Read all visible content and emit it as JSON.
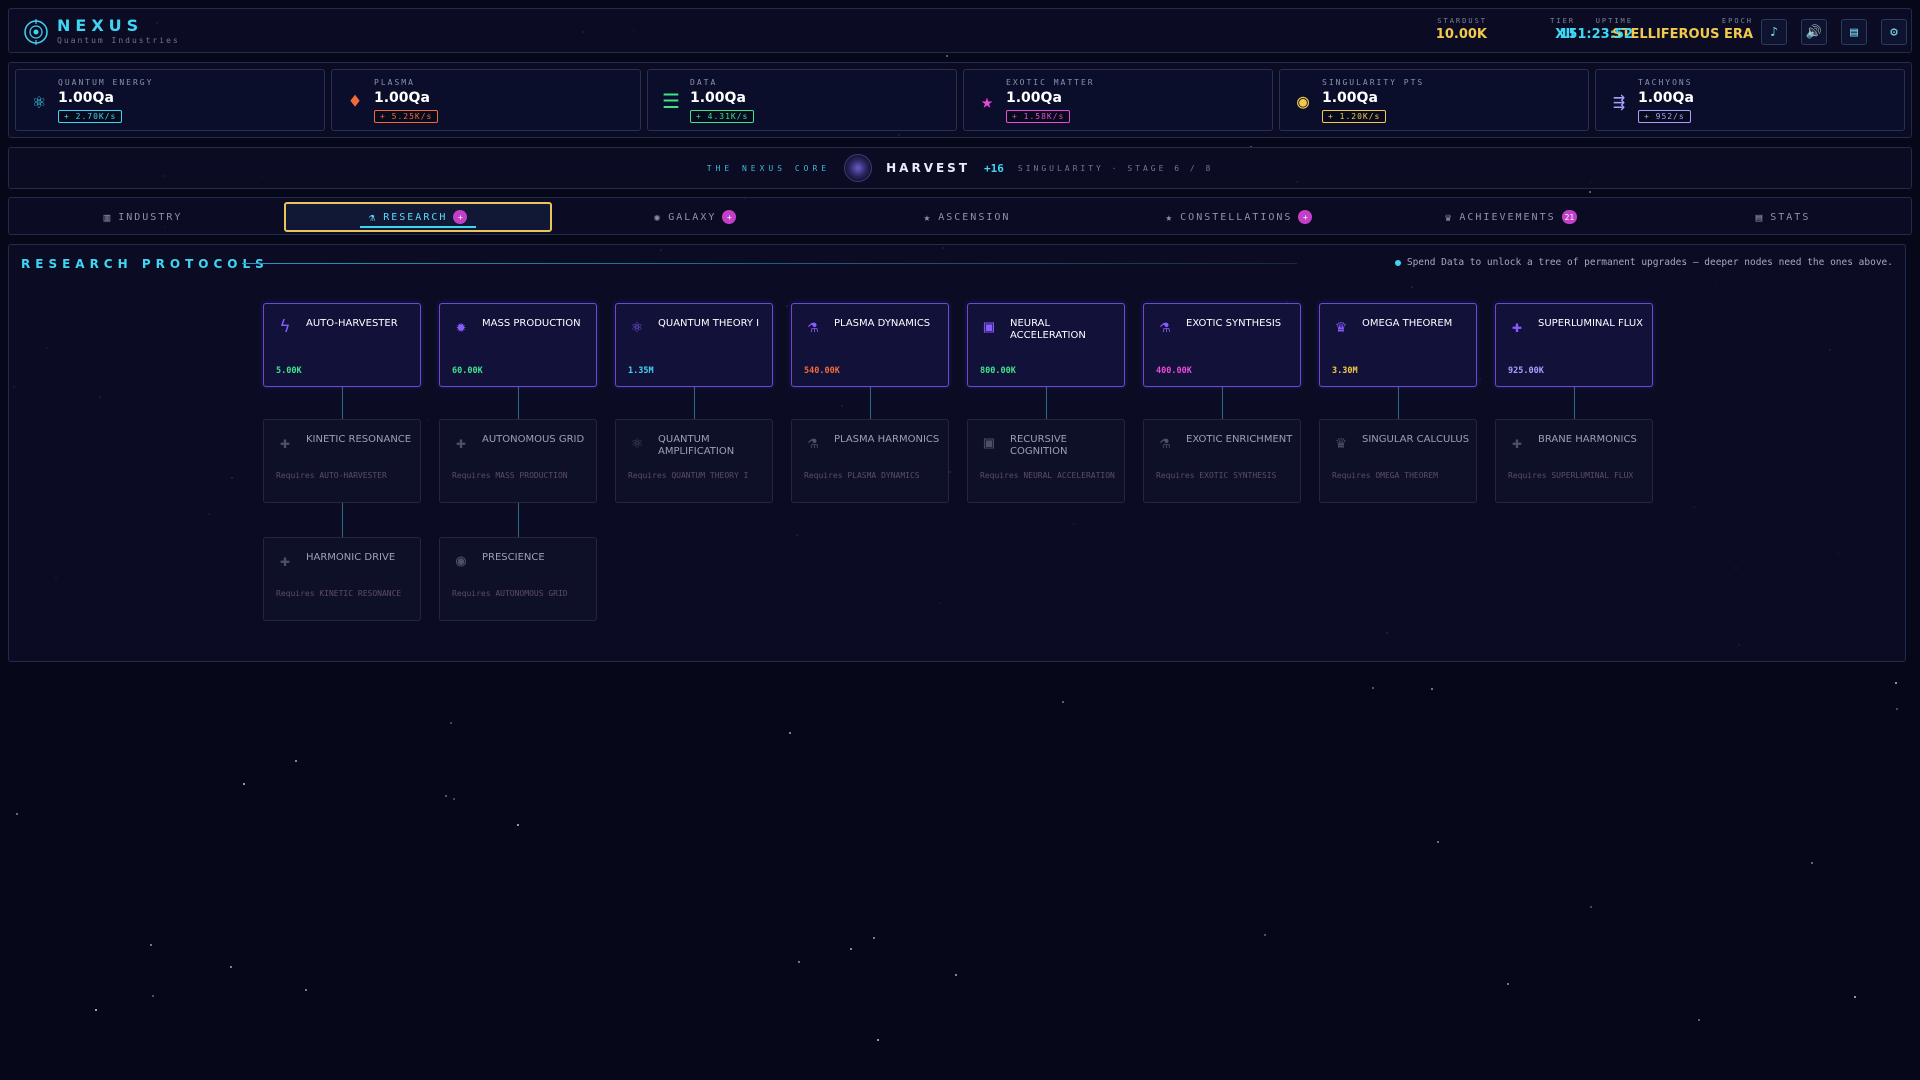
{
  "header": {
    "brand_title": "NEXUS",
    "brand_subtitle": "Quantum Industries",
    "stats": [
      {
        "label": "EPOCH",
        "value": "STELLIFEROUS ERA",
        "color": "#f2c94c"
      },
      {
        "label": "UPTIME",
        "value": "151:23:52",
        "color": "#3fd6f4"
      },
      {
        "label": "TIER",
        "value": "XII",
        "color": "#3fd6f4"
      },
      {
        "label": "STARDUST",
        "value": "10.00K",
        "color": "#f2c94c"
      }
    ],
    "buttons": [
      {
        "name": "music-button",
        "icon": "music-note-icon",
        "glyph": "♪"
      },
      {
        "name": "sound-button",
        "icon": "speaker-icon",
        "glyph": "🔊"
      },
      {
        "name": "log-button",
        "icon": "document-icon",
        "glyph": "▤"
      },
      {
        "name": "settings-button",
        "icon": "gear-icon",
        "glyph": "⚙"
      }
    ]
  },
  "resources": [
    {
      "label": "QUANTUM ENERGY",
      "value": "1.00Qa",
      "rate": "+ 2.70K/s",
      "icon": "atom-icon",
      "glyph": "⚛",
      "color": "#3fd6f4"
    },
    {
      "label": "PLASMA",
      "value": "1.00Qa",
      "rate": "+ 5.25K/s",
      "icon": "plasma-flame-icon",
      "glyph": "♦",
      "color": "#f26a3c"
    },
    {
      "label": "DATA",
      "value": "1.00Qa",
      "rate": "+ 4.31K/s",
      "icon": "data-stack-icon",
      "glyph": "☰",
      "color": "#3ee38a"
    },
    {
      "label": "EXOTIC MATTER",
      "value": "1.00Qa",
      "rate": "+ 1.58K/s",
      "icon": "star-icon",
      "glyph": "★",
      "color": "#e84bd8"
    },
    {
      "label": "SINGULARITY PTS",
      "value": "1.00Qa",
      "rate": "+ 1.20K/s",
      "icon": "singularity-icon",
      "glyph": "◉",
      "color": "#f2c94c"
    },
    {
      "label": "TACHYONS",
      "value": "1.00Qa",
      "rate": "+ 952/s",
      "icon": "tachyon-icon",
      "glyph": "⇶",
      "color": "#a8a0ff"
    }
  ],
  "core": {
    "title": "THE NEXUS CORE",
    "action": "HARVEST",
    "bonus": "+16",
    "stage": "SINGULARITY · STAGE 6 / 8"
  },
  "tabs": [
    {
      "label": "INDUSTRY",
      "icon": "bar-chart-icon",
      "glyph": "▥",
      "badge": "",
      "active": false
    },
    {
      "label": "RESEARCH",
      "icon": "flask-icon",
      "glyph": "⚗",
      "badge": "+",
      "active": true
    },
    {
      "label": "GALAXY",
      "icon": "galaxy-icon",
      "glyph": "✺",
      "badge": "+",
      "active": false
    },
    {
      "label": "ASCENSION",
      "icon": "star-icon",
      "glyph": "★",
      "badge": "",
      "active": false
    },
    {
      "label": "CONSTELLATIONS",
      "icon": "constellation-icon",
      "glyph": "★",
      "badge": "+",
      "active": false
    },
    {
      "label": "ACHIEVEMENTS",
      "icon": "trophy-icon",
      "glyph": "♛",
      "badge": "21",
      "active": false
    },
    {
      "label": "STATS",
      "icon": "stats-icon",
      "glyph": "▤",
      "badge": "",
      "active": false
    }
  ],
  "research": {
    "title": "RESEARCH PROTOCOLS",
    "hint": "Spend Data to unlock a tree of permanent upgrades — deeper nodes need the ones above.",
    "tier1": [
      {
        "name": "AUTO-HARVESTER",
        "cost": "5.00K",
        "cost_color": "#3ee38a",
        "icon": "lightning-icon",
        "glyph": "ϟ",
        "color": "#8a5cff"
      },
      {
        "name": "MASS PRODUCTION",
        "cost": "60.00K",
        "cost_color": "#3ee38a",
        "icon": "cog-icon",
        "glyph": "✹",
        "color": "#8a5cff"
      },
      {
        "name": "QUANTUM THEORY I",
        "cost": "1.35M",
        "cost_color": "#3fd6f4",
        "icon": "atom-icon",
        "glyph": "⚛",
        "color": "#8a5cff"
      },
      {
        "name": "PLASMA DYNAMICS",
        "cost": "540.00K",
        "cost_color": "#f26a3c",
        "icon": "flask-icon",
        "glyph": "⚗",
        "color": "#8a5cff"
      },
      {
        "name": "NEURAL ACCELERATION",
        "cost": "800.00K",
        "cost_color": "#3ee38a",
        "icon": "chip-icon",
        "glyph": "▣",
        "color": "#8a5cff"
      },
      {
        "name": "EXOTIC SYNTHESIS",
        "cost": "400.00K",
        "cost_color": "#e84bd8",
        "icon": "flask-icon",
        "glyph": "⚗",
        "color": "#8a5cff"
      },
      {
        "name": "OMEGA THEOREM",
        "cost": "3.30M",
        "cost_color": "#f2c94c",
        "icon": "crown-icon",
        "glyph": "♛",
        "color": "#8a5cff"
      },
      {
        "name": "SUPERLUMINAL FLUX",
        "cost": "925.00K",
        "cost_color": "#a8a0ff",
        "icon": "sparkle-icon",
        "glyph": "✚",
        "color": "#8a5cff"
      }
    ],
    "tier2": [
      {
        "name": "KINETIC RESONANCE",
        "req": "Requires AUTO-HARVESTER",
        "icon": "cross-icon",
        "glyph": "✚"
      },
      {
        "name": "AUTONOMOUS GRID",
        "req": "Requires MASS PRODUCTION",
        "icon": "cross-icon",
        "glyph": "✚"
      },
      {
        "name": "QUANTUM AMPLIFICATION",
        "req": "Requires QUANTUM THEORY I",
        "icon": "atom-icon",
        "glyph": "⚛"
      },
      {
        "name": "PLASMA HARMONICS",
        "req": "Requires PLASMA DYNAMICS",
        "icon": "flask-icon",
        "glyph": "⚗"
      },
      {
        "name": "RECURSIVE COGNITION",
        "req": "Requires NEURAL ACCELERATION",
        "icon": "chip-icon",
        "glyph": "▣"
      },
      {
        "name": "EXOTIC ENRICHMENT",
        "req": "Requires EXOTIC SYNTHESIS",
        "icon": "flask-icon",
        "glyph": "⚗"
      },
      {
        "name": "SINGULAR CALCULUS",
        "req": "Requires OMEGA THEOREM",
        "icon": "crown-icon",
        "glyph": "♛"
      },
      {
        "name": "BRANE HARMONICS",
        "req": "Requires SUPERLUMINAL FLUX",
        "icon": "cross-icon",
        "glyph": "✚"
      }
    ],
    "tier3": [
      {
        "name": "HARMONIC DRIVE",
        "req": "Requires KINETIC RESONANCE",
        "icon": "cross-icon",
        "glyph": "✚"
      },
      {
        "name": "PRESCIENCE",
        "req": "Requires AUTONOMOUS GRID",
        "icon": "eye-icon",
        "glyph": "◉"
      }
    ]
  }
}
